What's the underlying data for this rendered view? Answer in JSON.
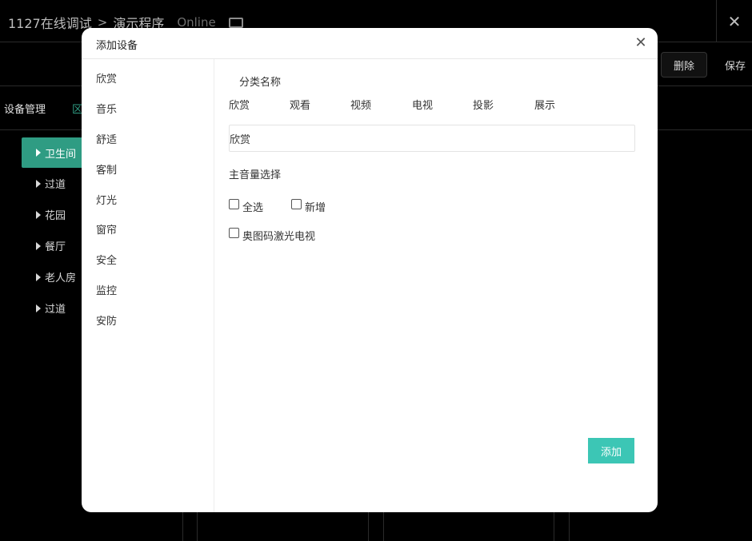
{
  "header": {
    "project": "1127在线调试",
    "program": "演示程序",
    "status": "Online",
    "monitor_icon": "monitor-icon",
    "close_icon": "close-icon"
  },
  "toolbar": {
    "delete_label": "删除",
    "save_label": "保存"
  },
  "tabs": {
    "device_management": "设备管理",
    "zone_partial": "区"
  },
  "tree": {
    "items": [
      {
        "label": "卫生间",
        "active": true
      },
      {
        "label": "过道"
      },
      {
        "label": "花园"
      },
      {
        "label": "餐厅"
      },
      {
        "label": "老人房"
      },
      {
        "label": "过道"
      }
    ]
  },
  "modal": {
    "title": "添加设备",
    "close_icon": "close-icon",
    "sidebar": [
      "欣赏",
      "音乐",
      "舒适",
      "客制",
      "灯光",
      "窗帘",
      "安全",
      "监控",
      "安防"
    ],
    "category_label": "分类名称",
    "categories": [
      "欣赏",
      "观看",
      "视频",
      "电视",
      "投影",
      "展示"
    ],
    "name_value": "欣赏",
    "volume_label": "主音量选择",
    "checkboxes": {
      "select_all": "全选",
      "add_new": "新增",
      "device": "奥图码激光电视"
    },
    "add_button": "添加"
  },
  "colors": {
    "accent": "#2f9c83",
    "add_button": "#3cc6b5"
  }
}
